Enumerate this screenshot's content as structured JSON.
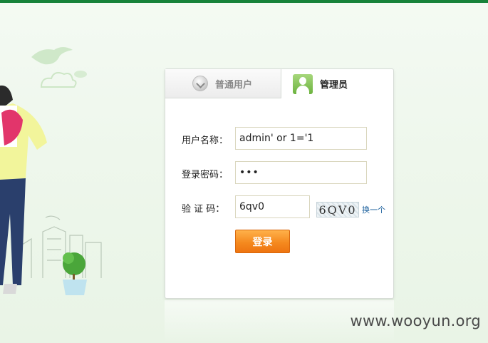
{
  "tabs": {
    "user_label": "普通用户",
    "admin_label": "管理员"
  },
  "form": {
    "username_label": "用户名称：",
    "username_value": "admin' or 1='1",
    "password_label": "登录密码：",
    "password_value": "•••",
    "captcha_label": "验 证 码：",
    "captcha_value": "6qv0",
    "captcha_image_text": "6QV0",
    "captcha_refresh": "换一个",
    "submit_label": "登录"
  },
  "watermark": "www.wooyun.org",
  "colors": {
    "top_bar": "#17823a",
    "button": "#f58a1f",
    "link": "#1a5f9c"
  }
}
